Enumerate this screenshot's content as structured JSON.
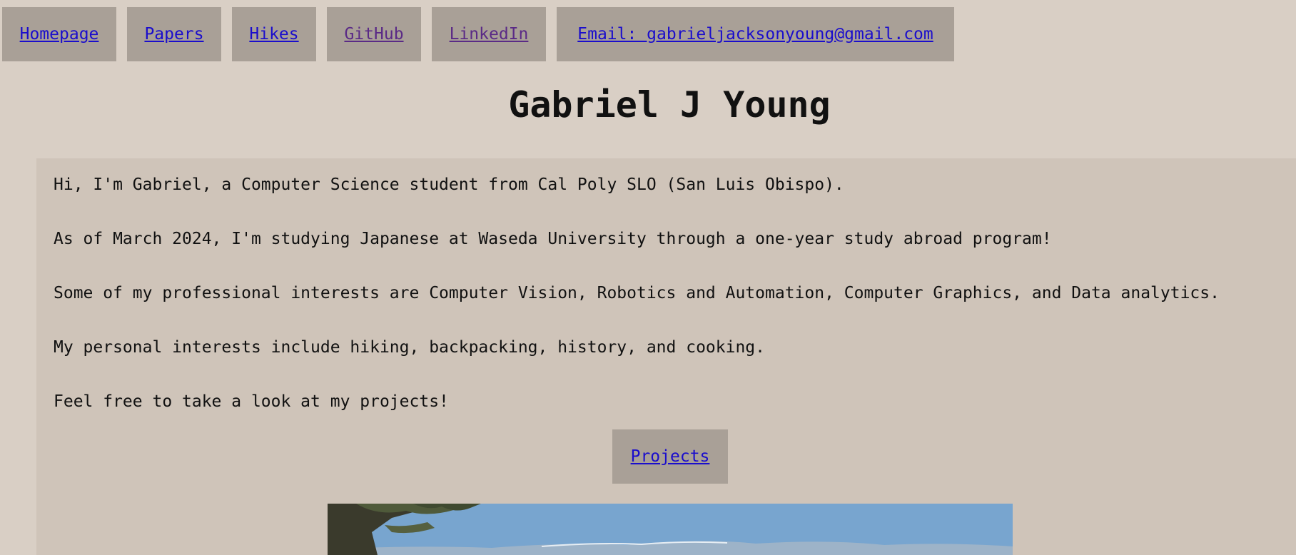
{
  "nav": {
    "homepage": "Homepage",
    "papers": "Papers",
    "hikes": "Hikes",
    "github": "GitHub",
    "linkedin": "LinkedIn",
    "email": "Email: gabrieljacksonyoung@gmail.com"
  },
  "page_title": "Gabriel J Young",
  "intro": {
    "p1": "Hi, I'm Gabriel, a Computer Science student from Cal Poly SLO (San Luis Obispo).",
    "p2": "As of March 2024, I'm studying Japanese at Waseda University through a one-year study abroad program!",
    "p3": "Some of my professional interests are Computer Vision, Robotics and Automation, Computer Graphics, and Data analytics.",
    "p4": "My personal interests include hiking, backpacking, history, and cooking.",
    "p5": "Feel free to take a look at my projects!"
  },
  "projects_label": "Projects",
  "colors": {
    "page_bg": "#d9cfc5",
    "content_bg": "#cfc4b9",
    "button_bg": "#a9a097",
    "link": "#1a0dcc",
    "visited_link": "#5a2a86"
  }
}
